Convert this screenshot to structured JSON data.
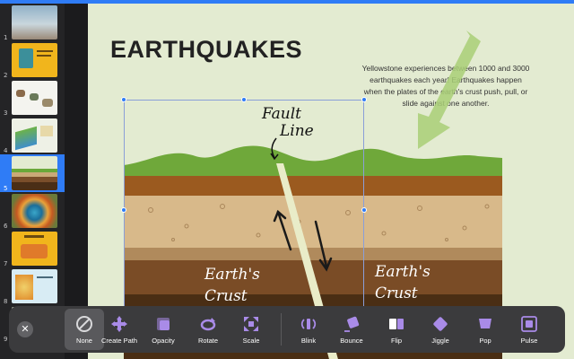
{
  "slides": [
    {
      "number": "1"
    },
    {
      "number": "2"
    },
    {
      "number": "3"
    },
    {
      "number": "4"
    },
    {
      "number": "5"
    },
    {
      "number": "6"
    },
    {
      "number": "7"
    },
    {
      "number": "8"
    },
    {
      "number": "9"
    }
  ],
  "slide": {
    "title": "EARTHQUAKES",
    "body": "Yellowstone experiences between 1000 and 3000 earthquakes each year! Earthquakes happen when the plates of the earth's crust push, pull, or slide against one another.",
    "diagram": {
      "fault_label_1": "Fault",
      "fault_label_2": "Line",
      "crust_left_1": "Earth's",
      "crust_left_2": "Crust",
      "crust_right_1": "Earth's",
      "crust_right_2": "Crust"
    }
  },
  "animation_bar": {
    "close_symbol": "✕",
    "tools": [
      {
        "label": "None",
        "icon": "none-icon"
      },
      {
        "label": "Create Path",
        "icon": "path-icon"
      },
      {
        "label": "Opacity",
        "icon": "opacity-icon"
      },
      {
        "label": "Rotate",
        "icon": "rotate-icon"
      },
      {
        "label": "Scale",
        "icon": "scale-icon"
      },
      {
        "label": "Blink",
        "icon": "blink-icon"
      },
      {
        "label": "Bounce",
        "icon": "bounce-icon"
      },
      {
        "label": "Flip",
        "icon": "flip-icon"
      },
      {
        "label": "Jiggle",
        "icon": "jiggle-icon"
      },
      {
        "label": "Pop",
        "icon": "pop-icon"
      },
      {
        "label": "Pulse",
        "icon": "pulse-icon"
      }
    ]
  },
  "colors": {
    "accent": "#2f7cf6",
    "icon_purple": "#a98be8",
    "slide_bg": "#e3ebd1"
  }
}
